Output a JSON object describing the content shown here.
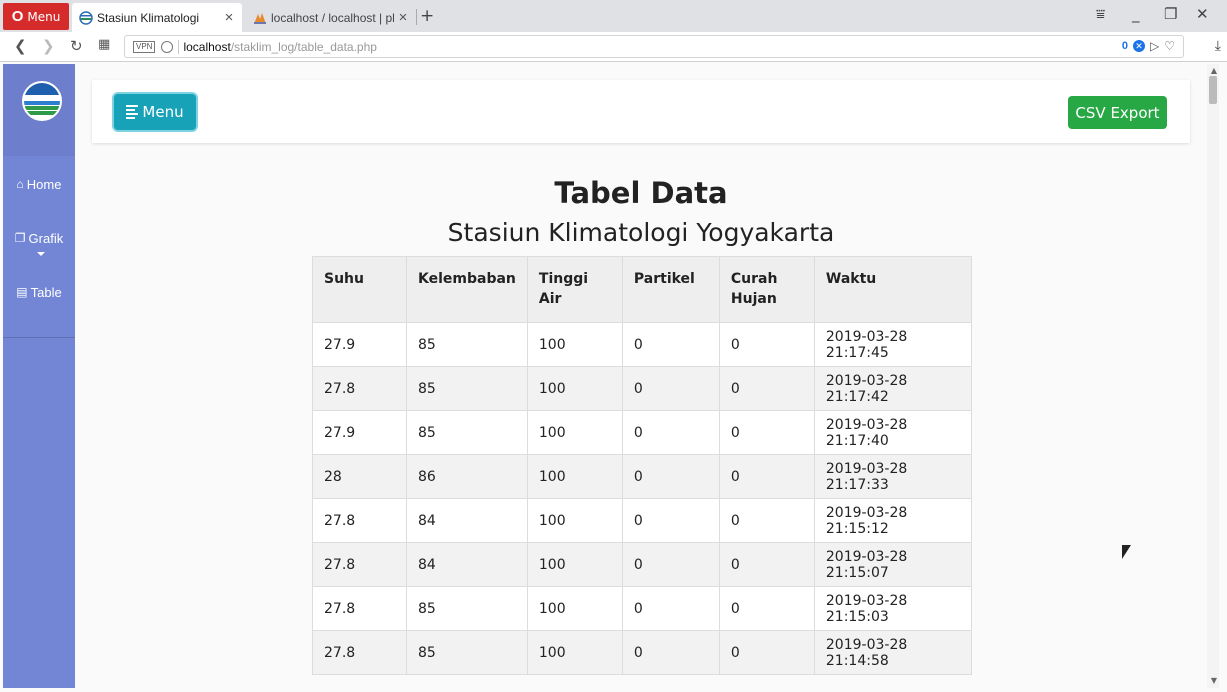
{
  "browser": {
    "menu_label": "Menu",
    "tabs": [
      {
        "title": "Stasiun Klimatologi",
        "active": true
      },
      {
        "title": "localhost / localhost | ph",
        "active": false
      }
    ],
    "url_host": "localhost",
    "url_path": "/staklim_log/table_data.php",
    "vpn_label": "VPN",
    "badge_count": "0"
  },
  "sidebar": {
    "items": [
      {
        "label": "Home",
        "icon": "home-icon"
      },
      {
        "label": "Grafik",
        "icon": "copy-icon"
      },
      {
        "label": "Table",
        "icon": "briefcase-icon"
      }
    ]
  },
  "toolbar": {
    "menu_label": "Menu",
    "csv_label": "CSV Export",
    "menu_color": "#17a2b8",
    "csv_color": "#28a745"
  },
  "page": {
    "title": "Tabel Data",
    "subtitle": "Stasiun Klimatologi Yogyakarta"
  },
  "table": {
    "headers": [
      "Suhu",
      "Kelembaban",
      "Tinggi Air",
      "Partikel",
      "Curah Hujan",
      "Waktu"
    ],
    "rows": [
      [
        "27.9",
        "85",
        "100",
        "0",
        "0",
        "2019-03-28 21:17:45"
      ],
      [
        "27.8",
        "85",
        "100",
        "0",
        "0",
        "2019-03-28 21:17:42"
      ],
      [
        "27.9",
        "85",
        "100",
        "0",
        "0",
        "2019-03-28 21:17:40"
      ],
      [
        "28",
        "86",
        "100",
        "0",
        "0",
        "2019-03-28 21:17:33"
      ],
      [
        "27.8",
        "84",
        "100",
        "0",
        "0",
        "2019-03-28 21:15:12"
      ],
      [
        "27.8",
        "84",
        "100",
        "0",
        "0",
        "2019-03-28 21:15:07"
      ],
      [
        "27.8",
        "85",
        "100",
        "0",
        "0",
        "2019-03-28 21:15:03"
      ],
      [
        "27.8",
        "85",
        "100",
        "0",
        "0",
        "2019-03-28 21:14:58"
      ]
    ]
  },
  "colors": {
    "sidebar": "#7386d5"
  }
}
